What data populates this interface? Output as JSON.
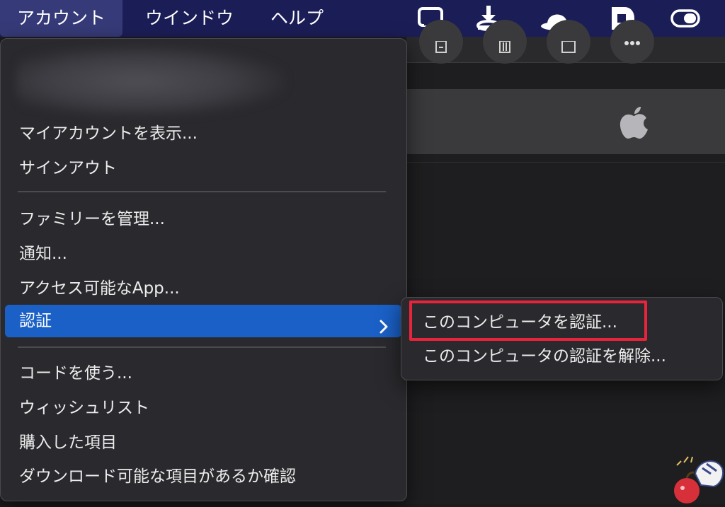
{
  "menubar": {
    "items": [
      {
        "label": "アカウント",
        "active": true
      },
      {
        "label": "ウインドウ",
        "active": false
      },
      {
        "label": "ヘルプ",
        "active": false
      }
    ],
    "status_icons": [
      "airplay-display-icon",
      "download-tray-icon",
      "hat-icon",
      "document-badge-icon",
      "toggle-switch-icon"
    ]
  },
  "app_window": {
    "toolbar_icons": [
      "report-icon",
      "trash-icon",
      "square-icon",
      "more-icon"
    ],
    "logo_icon": "apple-logo-icon"
  },
  "menu": {
    "groups": [
      {
        "items": [
          {
            "label": "マイアカウントを表示..."
          },
          {
            "label": "サインアウト"
          }
        ]
      },
      {
        "items": [
          {
            "label": "ファミリーを管理..."
          },
          {
            "label": "通知..."
          },
          {
            "label": "アクセス可能なApp..."
          },
          {
            "label": "認証",
            "has_submenu": true,
            "highlighted": true
          }
        ]
      },
      {
        "items": [
          {
            "label": "コードを使う..."
          },
          {
            "label": "ウィッシュリスト"
          },
          {
            "label": "購入した項目"
          },
          {
            "label": "ダウンロード可能な項目があるか確認"
          }
        ]
      }
    ]
  },
  "submenu": {
    "items": [
      {
        "label": "このコンピュータを認証...",
        "callout": true
      },
      {
        "label": "このコンピュータの認証を解除..."
      }
    ]
  },
  "colors": {
    "menubar_bg": "#1b1d57",
    "menu_bg": "#2a2a2e",
    "highlight": "#1a60c6",
    "callout": "#e8243c"
  }
}
